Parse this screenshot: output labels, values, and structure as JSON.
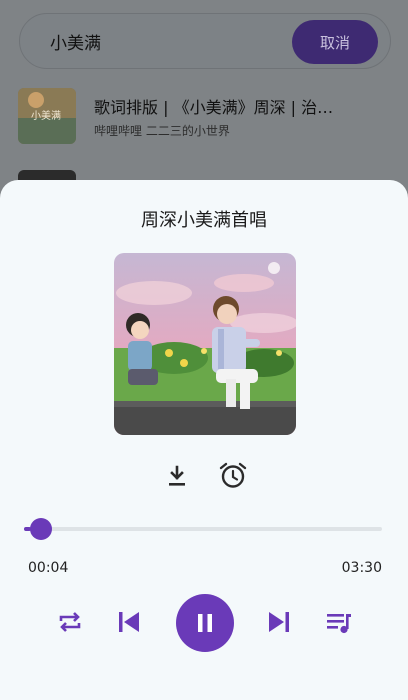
{
  "search": {
    "query": "小美满",
    "cancel_label": "取消"
  },
  "results": [
    {
      "title": "歌词排版 | 《小美满》周深 | 治…",
      "subtitle": "哔哩哔哩  二二三的小世界",
      "thumb_text": "小美满"
    }
  ],
  "player": {
    "title": "周深小美满首唱",
    "current_time": "00:04",
    "total_time": "03:30",
    "progress": 0.019,
    "is_playing": true,
    "icons": {
      "download": "download-icon",
      "alarm": "alarm-clock-icon",
      "repeat": "repeat-icon",
      "previous": "skip-previous-icon",
      "play_pause": "pause-icon",
      "next": "skip-next-icon",
      "queue": "playlist-icon"
    }
  },
  "colors": {
    "accent": "#6a3ab8",
    "sheet_background": "#f4f9fb",
    "scrim": "#7f8386"
  }
}
